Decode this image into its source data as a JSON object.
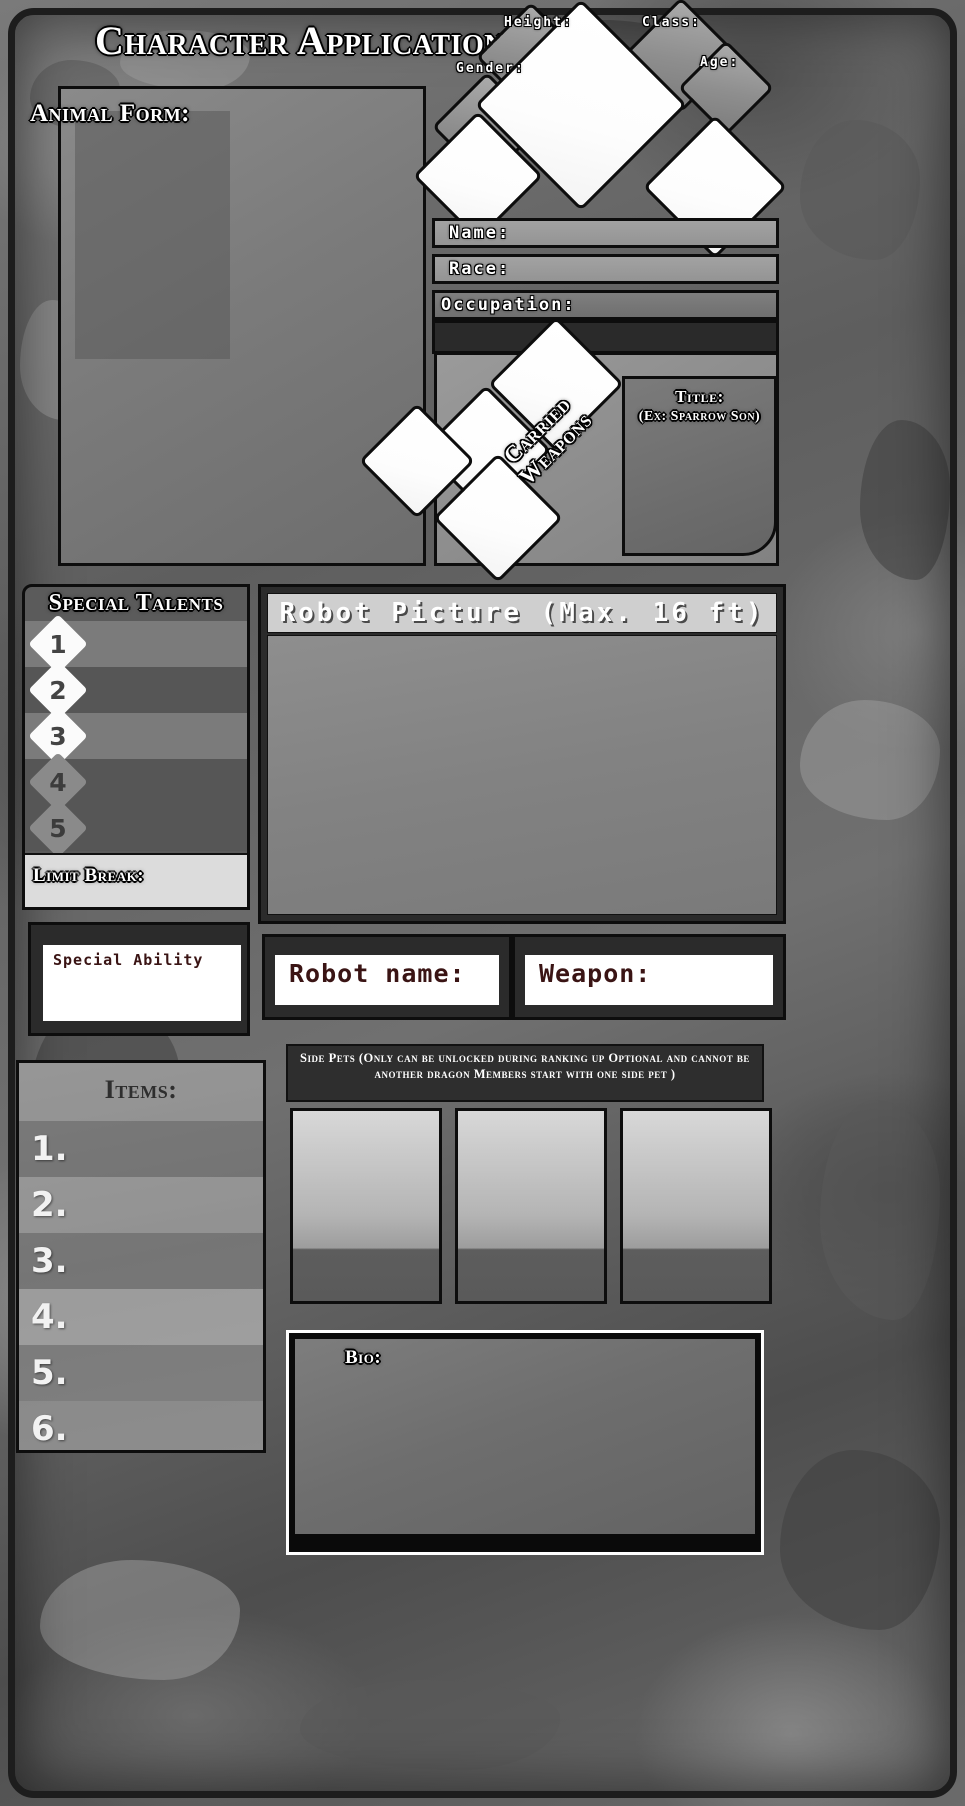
{
  "page": {
    "title": "Character Application"
  },
  "animal_form": {
    "label": "Animal Form:"
  },
  "stat_diamonds": [
    {
      "key": "height",
      "label": "Height:"
    },
    {
      "key": "class",
      "label": "Class:"
    },
    {
      "key": "gender",
      "label": "Gender:"
    },
    {
      "key": "age",
      "label": "Age:"
    }
  ],
  "info_rows": [
    {
      "key": "name",
      "label": "Name:",
      "value": ""
    },
    {
      "key": "race",
      "label": "Race:",
      "value": ""
    },
    {
      "key": "occupation",
      "label": "Occupation:",
      "value": ""
    }
  ],
  "carried_weapons": {
    "label_line1": "Carried",
    "label_line2": "Weapons"
  },
  "title_tag": {
    "line1": "Title:",
    "line2": "(Ex: Sparrow Son)"
  },
  "special_talents": {
    "header": "Special Talents",
    "rows": [
      {
        "number": "1",
        "filled": true,
        "value": ""
      },
      {
        "number": "2",
        "filled": true,
        "value": ""
      },
      {
        "number": "3",
        "filled": true,
        "value": ""
      },
      {
        "number": "4",
        "filled": false,
        "value": ""
      },
      {
        "number": "5",
        "filled": false,
        "value": ""
      }
    ],
    "limit_break_label": "Limit Break:",
    "limit_break_value": ""
  },
  "special_ability": {
    "label": "Special Ability",
    "value": ""
  },
  "items": {
    "header": "Items:",
    "rows": [
      {
        "number": "1.",
        "value": ""
      },
      {
        "number": "2.",
        "value": ""
      },
      {
        "number": "3.",
        "value": ""
      },
      {
        "number": "4.",
        "value": ""
      },
      {
        "number": "5.",
        "value": ""
      },
      {
        "number": "6.",
        "value": ""
      }
    ]
  },
  "robot": {
    "picture_header": "Robot Picture (Max. 16 ft)",
    "name_label": "Robot name:",
    "name_value": "",
    "weapon_label": "Weapon:",
    "weapon_value": ""
  },
  "side_pets": {
    "caption": "Side Pets (Only can be unlocked during ranking up  Optional and cannot be another dragon  Members start with one side pet )",
    "slots": [
      {
        "value": ""
      },
      {
        "value": ""
      },
      {
        "value": ""
      }
    ]
  },
  "bio": {
    "label": "Bio:",
    "value": ""
  },
  "colors": {
    "frame_border": "#1d1d1d",
    "panel_dark": "#2b2b2b",
    "panel_mid": "#5b5b5b",
    "panel_light": "#dcdcdc",
    "field_white": "#ffffff",
    "label_dark_red": "#3a1414",
    "bg_gray": "#6f6f6f"
  }
}
